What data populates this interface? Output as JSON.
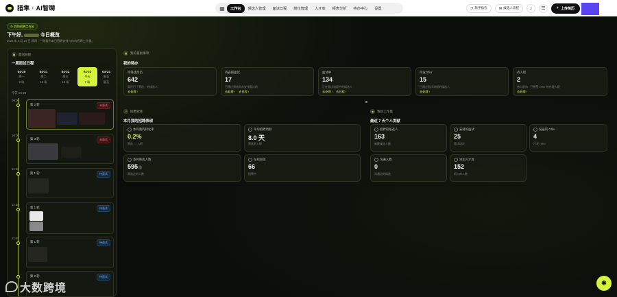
{
  "app": {
    "name": "猎隼 · AI智聘"
  },
  "nav": {
    "items": [
      "工作台",
      "候选人管理",
      "面试日程",
      "岗位管理",
      "人才库",
      "报表分析",
      "待办中心",
      "设置"
    ],
    "active_index": 0
  },
  "top_actions": {
    "guide": "新手指引",
    "candidate_flow": "候选人流程",
    "upload": "上传简历"
  },
  "home_badge": "我的招聘工作台",
  "greeting": {
    "prefix": "下午好,",
    "suffix": "今日概览",
    "sub": "2026 年 4 月 23 日 周四 · 一眼看到本日招聘安排与你的招聘工作量。"
  },
  "schedule": {
    "tag": "面试日程",
    "title": "一周面试日程",
    "dates": [
      {
        "d": "04-20",
        "w": "周一",
        "c": "9 场"
      },
      {
        "d": "04-21",
        "w": "周二",
        "c": "13 场"
      },
      {
        "d": "04-22",
        "w": "周三",
        "c": "13 场"
      },
      {
        "d": "04-23",
        "w": "今天",
        "c": "7 场"
      },
      {
        "d": "04-24",
        "w": "周五",
        "c": "暂无"
      }
    ],
    "active_date_index": 3,
    "today_label": "今天 04-23",
    "slots": [
      {
        "time": "09:00",
        "round": "第 2 轮",
        "status": "未面试",
        "status_type": "red"
      },
      {
        "time": "10:00",
        "round": "第 3 轮",
        "status": "未面试",
        "status_type": "red"
      },
      {
        "time": "11:00",
        "round": "第 1 轮",
        "status": "待面试",
        "status_type": "blue"
      },
      {
        "time": "11:30",
        "round": "第 1 轮",
        "status": "待面试",
        "status_type": "blue"
      },
      {
        "time": "11:40",
        "round": "第 1 轮",
        "status": "待面试",
        "status_type": "blue"
      },
      {
        "time": "",
        "round": "第 2 轮",
        "status": "待面试",
        "status_type": "blue"
      }
    ]
  },
  "todo": {
    "tag": "我的看板事项",
    "title": "我的待办",
    "cards": [
      {
        "label": "待筛选简历",
        "value": "642",
        "desc": "简历已「筛选」的候选人",
        "links": [
          "去处理 ›"
        ]
      },
      {
        "label": "待安排面试",
        "value": "17",
        "desc": "已通过筛选尚未安排面试的",
        "links": [
          "去处理 ›",
          "去日程 ›"
        ]
      },
      {
        "label": "面试中",
        "value": "134",
        "desc": "正在面试流程中的候选人",
        "links": [
          "去处理 ›",
          "去日程 ›"
        ]
      },
      {
        "label": "待发Offer",
        "value": "15",
        "desc": "已通过面试流程的候选人",
        "links": [
          "去处理 ›"
        ]
      },
      {
        "label": "待入职",
        "value": "2",
        "desc": "待入职的 · 已接受 Offer 待办理入职",
        "links": [
          "去处理 ›"
        ]
      }
    ]
  },
  "performance": {
    "tag": "招聘效率",
    "title": "本月我的招聘表现",
    "cards": [
      {
        "label": "本月我的转化率",
        "value": "0.2%",
        "desc": "筛选 → 入职",
        "accent": true
      },
      {
        "label": "平均招聘周期",
        "value": "8.0 天",
        "desc": "筛选到入职",
        "accent": false
      },
      {
        "label": "本月筛选人数",
        "value": "595",
        "unit": "份",
        "desc": "筛选过的人数",
        "accent": false
      },
      {
        "label": "在招岗位",
        "value": "66",
        "desc": "招聘中",
        "accent": false
      }
    ]
  },
  "workload": {
    "tag": "我的工作量",
    "title": "最近 7 天个人贡献",
    "cards": [
      {
        "label": "招聘的候选人",
        "value": "163",
        "desc": "新建候选人数"
      },
      {
        "label": "安排的面试",
        "value": "25",
        "desc": "面试场次"
      },
      {
        "label": "发送的 Offer",
        "value": "4",
        "desc": "已发 Offer"
      },
      {
        "label": "沟通人数",
        "value": "0",
        "desc": "沟通过的候选"
      },
      {
        "label": "添加人才库",
        "value": "152",
        "desc": "新入库人数"
      }
    ]
  },
  "watermark": "大数跨境"
}
